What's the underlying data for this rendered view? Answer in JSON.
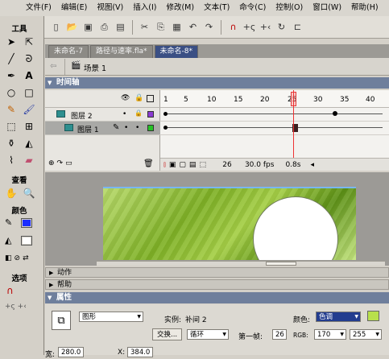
{
  "menu": [
    "文件(F)",
    "编辑(E)",
    "视图(V)",
    "插入(I)",
    "修改(M)",
    "文本(T)",
    "命令(C)",
    "控制(O)",
    "窗口(W)",
    "帮助(H)"
  ],
  "tools_panel": {
    "title": "工具",
    "view_title": "查看",
    "colors_title": "颜色",
    "options_title": "选项",
    "stroke_color": "#1a2cff",
    "fill_color": "#ffffff"
  },
  "doc_tabs": [
    "未命名-7",
    "路径与速率.fla*",
    "未命名-8*"
  ],
  "active_tab_index": 2,
  "scene": "场景 1",
  "timeline": {
    "title": "时间轴",
    "ruler": [
      "1",
      "5",
      "10",
      "15",
      "20",
      "25",
      "30",
      "35",
      "40"
    ],
    "playhead_frame": 25,
    "layers": [
      {
        "name": "图层 2",
        "color": "#8a3bd1"
      },
      {
        "name": "图层 1",
        "color": "#27c227"
      }
    ],
    "current_frame": "26",
    "fps": "30.0 fps",
    "time": "0.8s"
  },
  "panels": {
    "actions": "动作",
    "help": "帮助",
    "properties": "属性"
  },
  "properties": {
    "type_value": "图形",
    "instance_label": "实例:",
    "instance_name": "补间 2",
    "swap_button": "交换...",
    "loop_value": "循环",
    "first_label": "第一帧:",
    "first_value": "26",
    "color_label": "颜色:",
    "color_value": "色调",
    "rgb_label": "RGB:",
    "r_value": "170",
    "g_value": "255",
    "color_swatch": "#b8e04c",
    "w_label": "宽:",
    "w_value": "280.0",
    "x_label": "X:",
    "x_value": "384.0"
  }
}
